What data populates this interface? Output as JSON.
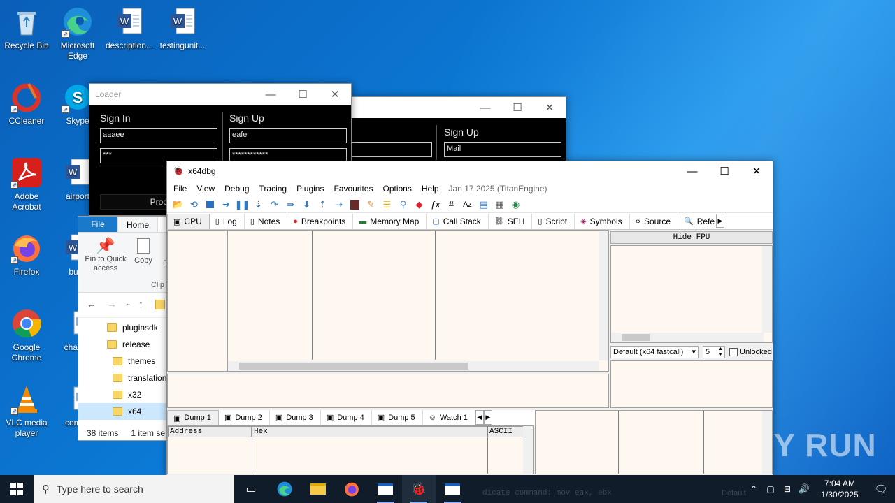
{
  "desktop": {
    "icons": [
      {
        "label": "Recycle Bin"
      },
      {
        "label": "Microsoft Edge"
      },
      {
        "label": "description..."
      },
      {
        "label": "testingunit..."
      },
      {
        "label": "CCleaner"
      },
      {
        "label": "Skype"
      },
      {
        "label": "Adobe Acrobat"
      },
      {
        "label": "airport"
      },
      {
        "label": "Firefox"
      },
      {
        "label": "build"
      },
      {
        "label": "Google Chrome"
      },
      {
        "label": "chance"
      },
      {
        "label": "VLC media player"
      },
      {
        "label": "comep"
      }
    ],
    "watermark": "ANY RUN"
  },
  "loader_front": {
    "title": "Loader",
    "signin_heading": "Sign In",
    "signup_heading": "Sign Up",
    "signin_user": "aaaee",
    "signin_pass": "***",
    "signup_user": "eafe",
    "signup_pass": "************",
    "proceed_label": "Proce"
  },
  "loader_back": {
    "signup_heading": "Sign Up",
    "mail_value": "Mail"
  },
  "explorer": {
    "tabs": {
      "file": "File",
      "home": "Home"
    },
    "ribbon": {
      "pin": "Pin to Quick access",
      "copy": "Copy",
      "paste_partial": "P",
      "group": "Clip"
    },
    "folders": [
      "pluginsdk",
      "release",
      "themes",
      "translation",
      "x32",
      "x64"
    ],
    "status_items": "38 items",
    "status_selected": "1 item se"
  },
  "x64dbg": {
    "title": "x64dbg",
    "menu": [
      "File",
      "View",
      "Debug",
      "Tracing",
      "Plugins",
      "Favourites",
      "Options",
      "Help"
    ],
    "build_info": "Jan 17 2025 (TitanEngine)",
    "tabs": [
      {
        "label": "CPU",
        "icon": "cpu-icon"
      },
      {
        "label": "Log",
        "icon": "log-icon"
      },
      {
        "label": "Notes",
        "icon": "notes-icon"
      },
      {
        "label": "Breakpoints",
        "icon": "breakpoint-icon"
      },
      {
        "label": "Memory Map",
        "icon": "memory-icon"
      },
      {
        "label": "Call Stack",
        "icon": "callstack-icon"
      },
      {
        "label": "SEH",
        "icon": "seh-icon"
      },
      {
        "label": "Script",
        "icon": "script-icon"
      },
      {
        "label": "Symbols",
        "icon": "symbols-icon"
      },
      {
        "label": "Source",
        "icon": "source-icon"
      },
      {
        "label": "Refe",
        "icon": "references-icon"
      }
    ],
    "hide_fpu": "Hide FPU",
    "calling_convention": "Default (x64 fastcall)",
    "arg_count": "5",
    "unlocked_label": "Unlocked",
    "dump_tabs": [
      "Dump 1",
      "Dump 2",
      "Dump 3",
      "Dump 4",
      "Dump 5",
      "Watch 1"
    ],
    "dump_headers": {
      "address": "Address",
      "hex": "Hex",
      "ascii": "ASCII"
    },
    "status_fragment": "dicate command: mov eax, ebx",
    "status_default": "Default"
  },
  "taskbar": {
    "search_placeholder": "Type here to search",
    "time": "7:04 AM",
    "date": "1/30/2025"
  }
}
